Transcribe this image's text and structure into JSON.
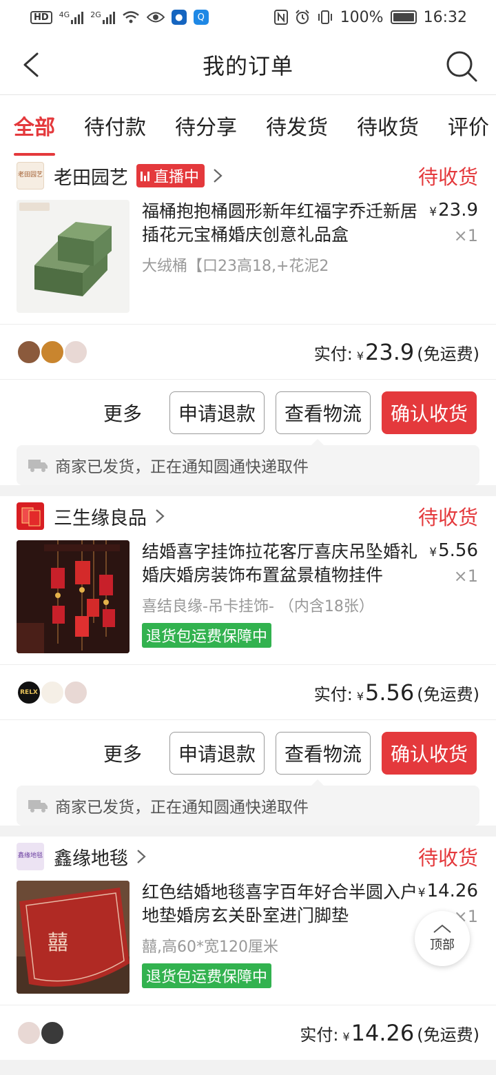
{
  "status_bar": {
    "left_chip": "HD",
    "net1": "4G",
    "net2": "2G",
    "battery": "100%",
    "time": "16:32"
  },
  "header": {
    "title": "我的订单"
  },
  "tabs": [
    "全部",
    "待付款",
    "待分享",
    "待发货",
    "待收货",
    "评价"
  ],
  "active_tab": "全部",
  "orders": [
    {
      "shop": "老田园艺",
      "shop_logo_text": "老田园艺",
      "live": "直播中",
      "status": "待收货",
      "title": "福桶抱抱桶圆形新年红福字乔迁新居插花元宝桶婚庆创意礼品盒",
      "spec": "大绒桶【口23高18,+花泥2",
      "price": "23.9",
      "qty": "×1",
      "paid_label": "实付:",
      "paid": "23.9",
      "shipping": "(免运费)",
      "more": "更多",
      "btn_refund": "申请退款",
      "btn_logistics": "查看物流",
      "btn_confirm": "确认收货",
      "notice": "商家已发货，正在通知圆通快递取件"
    },
    {
      "shop": "三生缘良品",
      "status": "待收货",
      "title": "结婚喜字挂饰拉花客厅喜庆吊坠婚礼婚庆婚房装饰布置盆景植物挂件",
      "spec": "喜结良缘-吊卡挂饰- （内含18张）",
      "guarantee": "退货包运费保障中",
      "price": "5.56",
      "qty": "×1",
      "avatar_text": "RELX",
      "paid_label": "实付:",
      "paid": "5.56",
      "shipping": "(免运费)",
      "more": "更多",
      "btn_refund": "申请退款",
      "btn_logistics": "查看物流",
      "btn_confirm": "确认收货",
      "notice": "商家已发货，正在通知圆通快递取件"
    },
    {
      "shop": "鑫缘地毯",
      "shop_logo_text": "鑫缘地毯",
      "status": "待收货",
      "title": "红色结婚地毯喜字百年好合半圆入户地垫婚房玄关卧室进门脚垫",
      "spec": "囍,高60*宽120厘米",
      "guarantee": "退货包运费保障中",
      "price": "14.26",
      "qty": "×1",
      "paid_label": "实付:",
      "paid": "14.26",
      "shipping": "(免运费)"
    }
  ],
  "currency": "¥",
  "top_button": "顶部",
  "colors": {
    "accent": "#e4393c",
    "guarantee": "#32b24f"
  }
}
